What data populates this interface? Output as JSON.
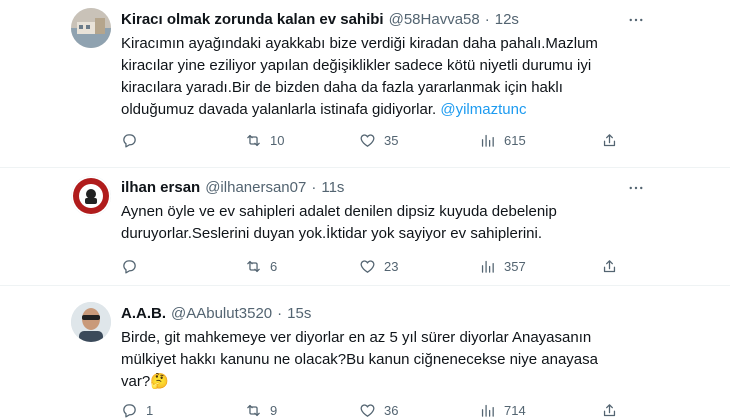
{
  "tweets": [
    {
      "name": "Kiracı olmak zorunda kalan ev sahibi",
      "handle": "@58Havva58",
      "dot": "·",
      "time": "12s",
      "text": "Kiracımın ayağındaki ayakkabı bize verdiği kiradan daha pahalı.Mazlum kiracılar yine eziliyor yapılan değişiklikler sadece kötü niyetli durumu iyi kiracılara yaradı.Bir de bizden daha da fazla yararlanmak için haklı olduğumuz davada yalanlarla istinafa gidiyorlar.",
      "mention": "@yilmaztunc",
      "replies": "",
      "retweets": "10",
      "likes": "35",
      "views": "615"
    },
    {
      "name": "ilhan ersan",
      "handle": "@ilhanersan07",
      "dot": "·",
      "time": "11s",
      "text": "Aynen öyle ve ev sahipleri adalet denilen dipsiz kuyuda debelenip duruyorlar.Seslerini duyan yok.İktidar yok sayiyor ev sahiplerini.",
      "replies": "",
      "retweets": "6",
      "likes": "23",
      "views": "357"
    },
    {
      "name": "A.A.B.",
      "handle": "@AAbulut3520",
      "dot": "·",
      "time": "15s",
      "text": "Birde, git mahkemeye ver diyorlar en az 5 yıl sürer diyorlar Anayasanın mülkiyet hakkı kanunu ne olacak?Bu kanun ciğnenecekse niye anayasa var?",
      "emoji": "🤔",
      "replies": "1",
      "retweets": "9",
      "likes": "36",
      "views": "714"
    }
  ],
  "icons": {
    "more": "more-horizontal-icon",
    "reply": "reply-icon",
    "retweet": "retweet-icon",
    "like": "heart-icon",
    "views": "views-chart-icon",
    "share": "share-icon"
  },
  "colors": {
    "text": "#0f1419",
    "secondary": "#536471",
    "link": "#1d9bf0",
    "divider": "#eff3f4"
  }
}
